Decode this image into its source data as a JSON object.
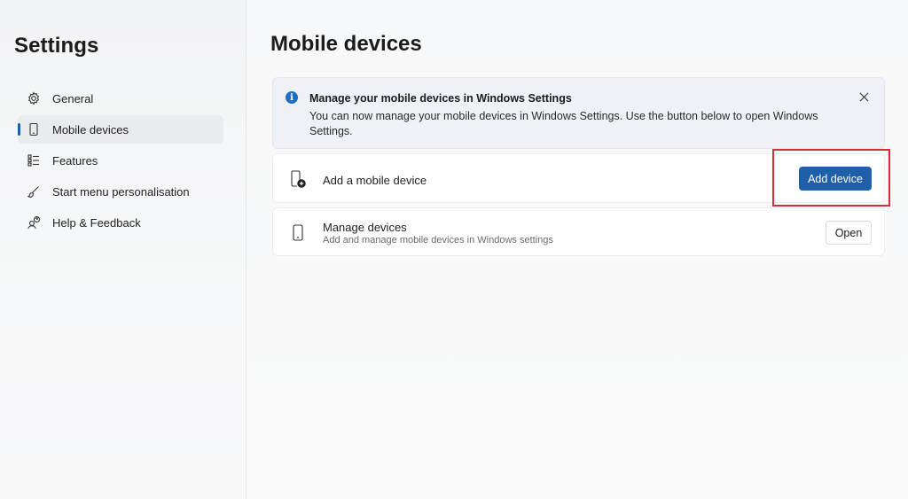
{
  "app": {
    "title": "Settings"
  },
  "sidebar": {
    "items": [
      {
        "label": "General",
        "icon": "gear-icon",
        "selected": false
      },
      {
        "label": "Mobile devices",
        "icon": "phone-icon",
        "selected": true
      },
      {
        "label": "Features",
        "icon": "features-list-icon",
        "selected": false
      },
      {
        "label": "Start menu personalisation",
        "icon": "brush-icon",
        "selected": false
      },
      {
        "label": "Help & Feedback",
        "icon": "help-people-icon",
        "selected": false
      }
    ]
  },
  "main": {
    "page_title": "Mobile devices",
    "info": {
      "title": "Manage your mobile devices in Windows Settings",
      "text": "You can now manage your mobile devices in Windows Settings. Use the button below to open Windows Settings."
    },
    "add_row": {
      "label": "Add a mobile device",
      "button": "Add device"
    },
    "manage_row": {
      "label": "Manage devices",
      "subtitle": "Add and manage mobile devices in Windows settings",
      "button": "Open"
    }
  },
  "colors": {
    "accent": "#1f5fa8",
    "info_icon": "#1f6fc4",
    "highlight": "#d32f3a"
  }
}
